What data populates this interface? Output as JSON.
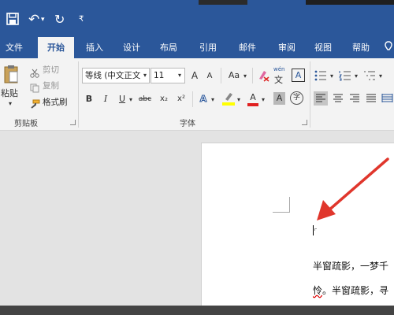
{
  "title_bar": {
    "quick_access": {
      "save_icon": "floppy-disk",
      "undo_glyph": "↶",
      "undo_dropdown": "▾",
      "redo_glyph": "↻",
      "customize_glyph": "₹"
    }
  },
  "tabs": [
    {
      "label": "文件"
    },
    {
      "label": "开始"
    },
    {
      "label": "插入"
    },
    {
      "label": "设计"
    },
    {
      "label": "布局"
    },
    {
      "label": "引用"
    },
    {
      "label": "邮件"
    },
    {
      "label": "审阅"
    },
    {
      "label": "视图"
    },
    {
      "label": "帮助"
    }
  ],
  "clipboard": {
    "paste": "粘贴",
    "cut": "剪切",
    "copy": "复制",
    "format_painter": "格式刷",
    "group_label": "剪贴板"
  },
  "font": {
    "font_name": "等线 (中文正文",
    "font_size": "11",
    "grow": "A",
    "shrink": "A",
    "change_case": "Aa",
    "pinyin_top": "wén",
    "pinyin_bottom": "文",
    "char_border": "A",
    "bold": "B",
    "italic": "I",
    "underline": "U",
    "strikethrough": "abc",
    "subscript": "x₂",
    "superscript": "x²",
    "text_effects": "A",
    "font_color": "A",
    "char_shading": "A",
    "enclose": "字",
    "group_label": "字体"
  },
  "colors": {
    "brand": "#2b579a",
    "highlight": "#ffff00",
    "font_color": "#e02020",
    "arrow": "#e0362c"
  },
  "document": {
    "line1": "半窗疏影，一梦千",
    "line2_first": "怜",
    "line2_rest": "。半窗疏影，寻"
  }
}
